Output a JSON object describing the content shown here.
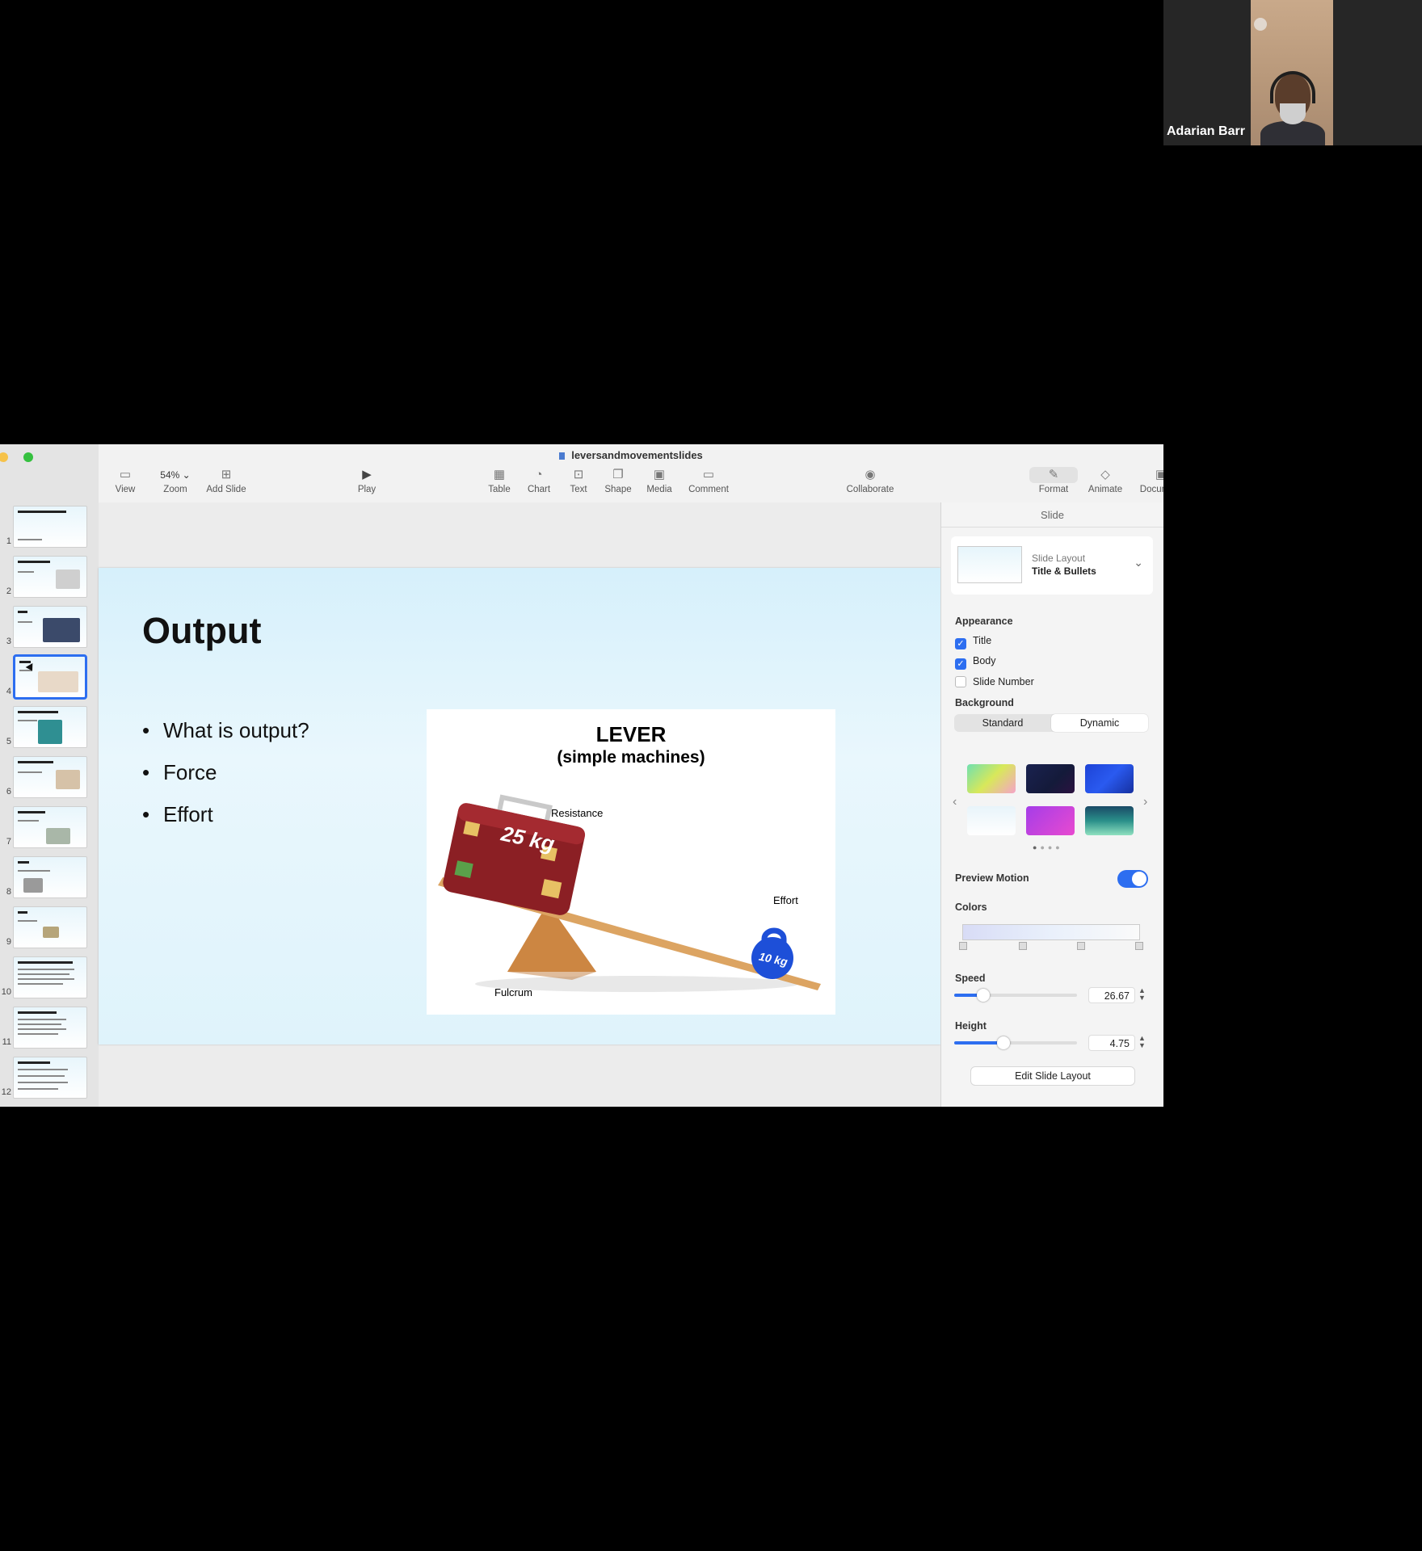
{
  "meeting": {
    "participant_name": "Adarian Barr"
  },
  "window": {
    "title": "leversandmovementslides"
  },
  "toolbar": {
    "view": "View",
    "zoom_value": "54%",
    "zoom": "Zoom",
    "add_slide": "Add Slide",
    "play": "Play",
    "table": "Table",
    "chart": "Chart",
    "text": "Text",
    "shape": "Shape",
    "media": "Media",
    "comment": "Comment",
    "collaborate": "Collaborate",
    "format": "Format",
    "animate": "Animate",
    "document": "Document"
  },
  "icons": {
    "view": "sidebar-icon",
    "zoom": "chevron-down-icon",
    "add_slide": "plus-square-icon",
    "play": "play-icon",
    "table": "table-icon",
    "chart": "chart-icon",
    "text": "text-box-icon",
    "shape": "shape-icon",
    "media": "image-icon",
    "comment": "comment-icon",
    "collaborate": "people-icon",
    "format": "paintbrush-icon",
    "animate": "diamond-icon",
    "document": "document-icon"
  },
  "navigator": {
    "selected": 4,
    "numbers": [
      "1",
      "2",
      "3",
      "4",
      "5",
      "6",
      "7",
      "8",
      "9",
      "10",
      "11",
      "12"
    ]
  },
  "slide": {
    "title": "Output",
    "bullets": [
      "What is output?",
      "Force",
      "Effort"
    ],
    "image": {
      "heading": "LEVER",
      "subheading": "(simple machines)",
      "resistance": "Resistance",
      "effort": "Effort",
      "fulcrum": "Fulcrum",
      "suitcase_weight": "25 kg",
      "kettlebell_weight": "10 kg"
    }
  },
  "inspector": {
    "tab": "Slide",
    "layout_label": "Slide Layout",
    "layout_value": "Title & Bullets",
    "appearance": "Appearance",
    "title_check": "Title",
    "title_checked": true,
    "body_check": "Body",
    "body_checked": true,
    "slide_number_check": "Slide Number",
    "slide_number_checked": false,
    "background": "Background",
    "standard": "Standard",
    "dynamic": "Dynamic",
    "selected_background_mode": "Dynamic",
    "swatch_colors": [
      "#6fe0b0",
      "#141a3a",
      "#1d43d6",
      "#f5f9fc",
      "#c23de8",
      "#2a8f8a"
    ],
    "preview_motion": "Preview Motion",
    "preview_motion_on": true,
    "colors": "Colors",
    "speed": "Speed",
    "speed_value": "26.67",
    "speed_fraction": 0.24,
    "height": "Height",
    "height_value": "4.75",
    "height_fraction": 0.4,
    "edit_layout": "Edit Slide Layout"
  },
  "colors": {
    "accent": "#2d6ef0",
    "suitcase": "#8b1f24",
    "kettlebell": "#1d4fd8",
    "plank": "#d9a05b"
  }
}
